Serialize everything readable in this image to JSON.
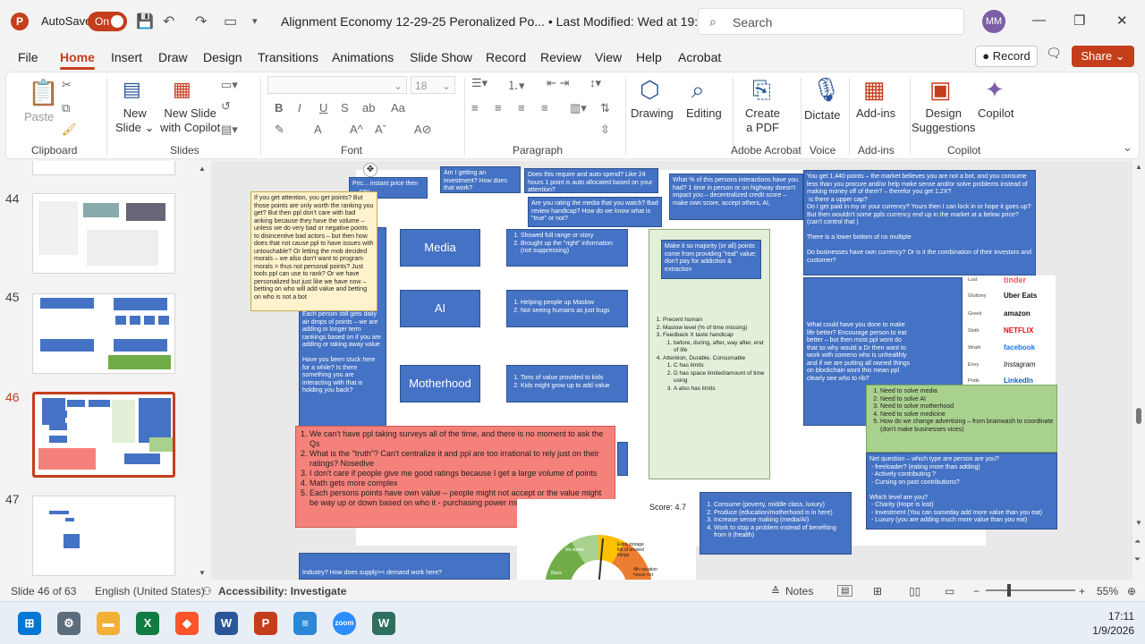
{
  "window": {
    "autosave_label": "AutoSave",
    "autosave_state": "On",
    "doc_title": "Alignment Economy 12-29-25 Peronalized Po... • Last Modified: Wed at 19:51 ⌄",
    "search_placeholder": "Search",
    "user_initials": "MM"
  },
  "menu": {
    "tabs": [
      "File",
      "Home",
      "Insert",
      "Draw",
      "Design",
      "Transitions",
      "Animations",
      "Slide Show",
      "Record",
      "Review",
      "View",
      "Help",
      "Acrobat"
    ],
    "record_label": "Record",
    "share_label": "Share"
  },
  "ribbon": {
    "clipboard": {
      "paste": "Paste",
      "label": "Clipboard"
    },
    "slides": {
      "new_slide": "New\nSlide ⌄",
      "new_slide_copilot": "New Slide\nwith Copilot",
      "label": "Slides"
    },
    "font": {
      "label": "Font",
      "size": "18"
    },
    "paragraph": {
      "label": "Paragraph"
    },
    "drawing": "Drawing",
    "editing": "Editing",
    "create_pdf": "Create\na PDF",
    "adobe_label": "Adobe Acrobat",
    "dictate": "Dictate",
    "voice_label": "Voice",
    "addins": "Add-ins",
    "addins_label": "Add-ins",
    "designer": "Design\nSuggestions",
    "copilot": "Copilot",
    "copilot_label": "Copilot"
  },
  "thumbnails": [
    {
      "num": "44"
    },
    {
      "num": "45"
    },
    {
      "num": "46"
    },
    {
      "num": "47"
    }
  ],
  "slide": {
    "top_stub_1": "Pric... instant price then ... pay",
    "top_stub_2": "Am I getting an investment? How does that work?",
    "top_stub_3": "Does this require and auto spend? Like 24 hours 1 point is auto allocated based on your attention?",
    "top_stub_4": "Are you rating the media that you watch? Bad review handicap? How do we know what is \"true\" or not?",
    "top_stub_5": "What % of this persons interactions have you had? 1 time in person or on highway doesn't impact you – decentralized credit score – make own score, accept others, AI,",
    "top_right": "You get 1,440 points – the market believes you are not a bot, and you consume less than you procure and/or help make sense and/or solve problems instead of making money off of them? – therefor you get 1.2X?\n is there a upper cap?\nDo I get paid in my or your currency? Yours then I can lock in or hope it goes up? But then wouldn't some ppls currency end up in the market at a below price? (can't control that )\n\nThere is a lower bottom of no multiple\n\nDo businesses have own currency? Or is it the combination of their investors and customer?",
    "cream_note": "If you get attention, you get points? But those points are only worth the ranking you get? But then ppl don't care with bad anking because they have the volume – unless we do very bad or negative points to disincentive bad actors – but then how does that not cause ppl to have issues with untouchable? Or letting the mob decided morals – we also don't want to program morals = thus not personal points? Just tools ppl can use to rank? Or we have personalized but just like we have now – betting on who will add value and betting on who is not a bot",
    "left_blue": "Each person still gets daily air drops of points – we are adding in longer term rankings based on if you are adding or taking away value\n\nHave you been stuck here for a while? Is there something you are interacting with that is holding you back?",
    "headers": [
      "Media",
      "AI",
      "Motherhood"
    ],
    "media_points": [
      "Showed full range or story",
      "Brought up the \"right\" information (not suppressing)"
    ],
    "ai_points": [
      "Helping people up Maslow",
      "Not seeing humans as just bugs"
    ],
    "mother_points": [
      "Tons of value provided to kids",
      "Kids might grow up to add value"
    ],
    "majority_box": "Make it so majority (or all) points come from providing \"real\" value; don't pay for addiction & extraction",
    "green_list": [
      "Precent human",
      "Maslow level (% of time missing)",
      "Feedback X taste handicap",
      "Attention, Durable, Consumable"
    ],
    "green_sub1": [
      "before, during, after, way after, end of life"
    ],
    "green_sub2": [
      "C has limits",
      "D has space limited/amount of time using",
      "A also has limits"
    ],
    "mid_right": "What could have you done to make life better? Encourage person to eat better – but then most ppl wont do that so why would a Dr then want to work with someno who is unhealthly and if we are putting all owned things on blockchain wont this mean ppl clearly see who to rib?",
    "sins": [
      {
        "sin": "Lust",
        "brand": "tinder"
      },
      {
        "sin": "Gluttony",
        "brand": "Uber Eats"
      },
      {
        "sin": "Greed",
        "brand": "amazon"
      },
      {
        "sin": "Sloth",
        "brand": "NETFLIX"
      },
      {
        "sin": "Wrath",
        "brand": "facebook"
      },
      {
        "sin": "Envy",
        "brand": "Instagram"
      },
      {
        "sin": "Pride",
        "brand": "LinkedIn"
      }
    ],
    "need_list": [
      "Need to solve media",
      "Need to solve AI",
      "Need to solve motherhood",
      "Need to solve medicine",
      "How do we change advertising – from brainwash to coordinate (don't make businesses vices)"
    ],
    "net_question": "Net question – which type are person are you?\n - freeloader? (eating more than adding)\n - Actively contributing ?\n - Cursing on past contributions?\n\nWhich level are you?\n - Charity (Hope is lost)\n - Investment (You can someday add more value than you eat)\n - Luxury (you are adding much more value than you eat)",
    "pink_list": [
      "We can't have ppl taking surveys all of the time, and there is no moment to ask the Qs",
      "What is the \"truth\"? Can't centralize it and ppl are too irrational to rely just on their ratings? Nosedive",
      "I don't care if people give me good ratings because I get a large volume of points",
      "Math gets more complex",
      "Each persons points have own value – people might not accept or the value might be way up or down based on who it - purchasing power might be fluid"
    ],
    "score_label": "Score: 4.7",
    "gauge_labels": [
      "No wants",
      "Extra storage full of unused things",
      "Basic",
      "4th vacation house not"
    ],
    "bottom_list": [
      "Consume (poverty, middle class, luxury)",
      "Produce (education/motherhood is in here)",
      "Increase sense making (media/AI)",
      "Work to stop a problem instead of benefiting from it (health)"
    ],
    "bottom_left": "Industry? How does supply>< demand work here?"
  },
  "status": {
    "slide_of": "Slide 46 of 63",
    "language": "English (United States)",
    "accessibility": "Accessibility: Investigate",
    "notes": "Notes",
    "zoom": "55%"
  },
  "taskbar": {
    "time": "17:11",
    "date": "1/9/2026"
  },
  "colors": {
    "accent": "#c43e1c",
    "slide_blue": "#4472c4",
    "slide_green": "#a9d18e",
    "slide_pink": "#f4817a"
  }
}
